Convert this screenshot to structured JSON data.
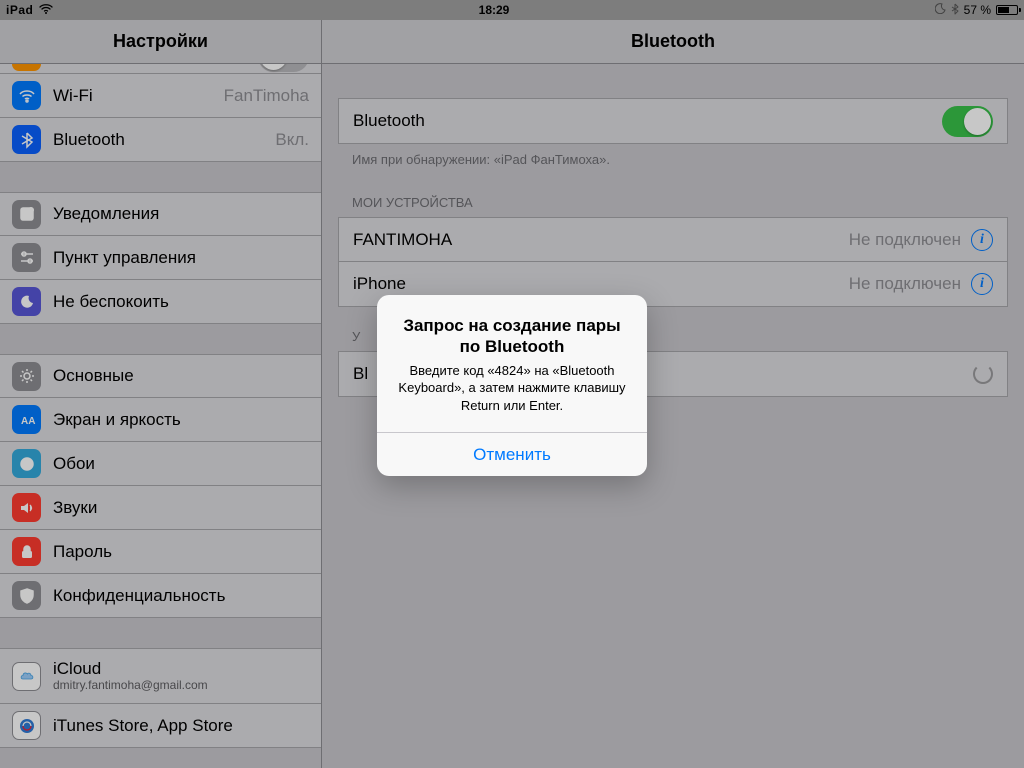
{
  "statusbar": {
    "carrier": "iPad",
    "time": "18:29",
    "battery_text": "57 %"
  },
  "sidebar": {
    "title": "Настройки",
    "rows": {
      "wifi": {
        "label": "Wi-Fi",
        "value": "FanTimoha"
      },
      "bluetooth": {
        "label": "Bluetooth",
        "value": "Вкл."
      },
      "notif": {
        "label": "Уведомления"
      },
      "control": {
        "label": "Пункт управления"
      },
      "dnd": {
        "label": "Не беспокоить"
      },
      "general": {
        "label": "Основные"
      },
      "display": {
        "label": "Экран и яркость"
      },
      "wallpaper": {
        "label": "Обои"
      },
      "sounds": {
        "label": "Звуки"
      },
      "passcode": {
        "label": "Пароль"
      },
      "privacy": {
        "label": "Конфиденциальность"
      },
      "icloud": {
        "label": "iCloud",
        "sub": "dmitry.fantimoha@gmail.com"
      },
      "itunes": {
        "label": "iTunes Store, App Store"
      }
    }
  },
  "detail": {
    "title": "Bluetooth",
    "bt_switch_label": "Bluetooth",
    "discoverable_note": "Имя при обнаружении: «iPad ФанТимоха».",
    "section_my_devices": "МОИ УСТРОЙСТВА",
    "devices": [
      {
        "name": "FANTIMOHA",
        "status": "Не подключен"
      },
      {
        "name": "iPhone",
        "status": "Не подключен"
      }
    ],
    "section_other": "У",
    "pairing_row_prefix": "Bl"
  },
  "alert": {
    "title": "Запрос на создание пары по Bluetooth",
    "message": "Введите код «4824» на «Bluetooth Keyboard», а затем нажмите клавишу Return или Enter.",
    "cancel": "Отменить"
  }
}
